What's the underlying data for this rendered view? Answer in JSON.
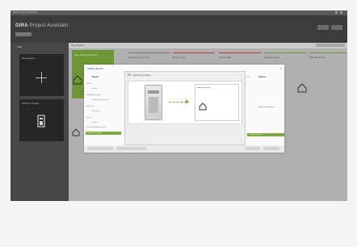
{
  "window": {
    "title": "GIRA Project Assistant"
  },
  "header": {
    "brand_prefix": "GIRA",
    "brand_rest": "Project Assistant"
  },
  "left_column": {
    "title": "Start",
    "tiles": [
      {
        "label": "New project"
      },
      {
        "label": "Archive / Import"
      }
    ]
  },
  "main": {
    "label": "My projects",
    "columns": [
      {
        "label": "New project (Gira X1)",
        "color": "#7cac3c"
      },
      {
        "label": "New project Gira X1",
        "color": "#888888"
      },
      {
        "label": "Gira / Lines",
        "color": "#cc4444"
      },
      {
        "label": "Lots of data",
        "color": "#888888"
      },
      {
        "label": "Legacy House",
        "color": "#7cac3c"
      },
      {
        "label": "Sample Home",
        "color": "#7cac3c"
      }
    ]
  },
  "modal": {
    "title": "Archive Device",
    "center_title": "Importing project ...",
    "left_header": "Name",
    "left_items": [
      "Gira X1",
      "Device 1",
      "Ventilation & Lights",
      "Control unit fluorescent",
      "Gira X1 Fx",
      "Gira X1 Fx",
      "Sensor",
      "Device 2",
      "Gira X1 Fx (Project) Gira X1",
      "Gira X1 Fx (Project)"
    ],
    "right_pre": "Fx",
    "right_header": "Status",
    "right_line": "Receiving to dialogue",
    "right_strip": "Project in Gira X1",
    "new_project_label": "New project name",
    "buttons": [
      "",
      "",
      "",
      ""
    ]
  },
  "colors": {
    "accent": "#7cac3c",
    "background": "#4a4a4a"
  },
  "icons": [
    "plus-icon",
    "house-icon",
    "device-icon",
    "arrow-right-icon",
    "close-icon"
  ]
}
